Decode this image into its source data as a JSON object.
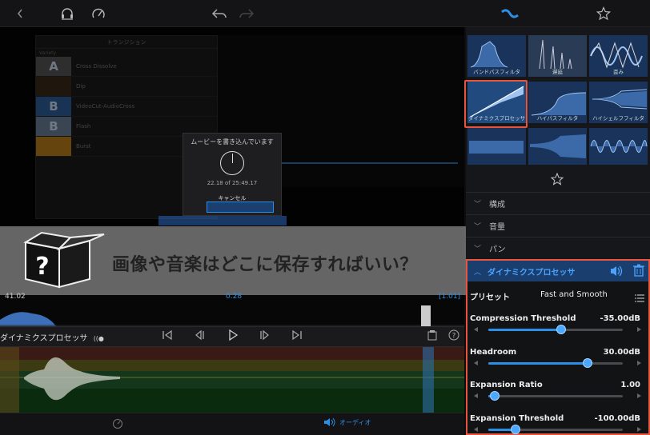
{
  "toolbar": {
    "icons": [
      "chevron-left-icon",
      "headphones-icon",
      "speedometer-icon",
      "undo-icon",
      "redo-icon",
      "effect-icon",
      "star-icon"
    ]
  },
  "transitions": {
    "title": "トランジション",
    "category": "Variety",
    "items": [
      {
        "label": "Cross Dissolve",
        "thumb": "A",
        "color": "#555"
      },
      {
        "label": "Dip",
        "thumb": "",
        "color": "#3a2a18"
      },
      {
        "label": "VideoCut-AudioCross",
        "thumb": "B",
        "color": "#2f5e9a"
      },
      {
        "label": "Flash",
        "thumb": "B",
        "color": "#6a7f99"
      },
      {
        "label": "Burst",
        "thumb": "",
        "color": "#b87d1a"
      }
    ]
  },
  "write_dialog": {
    "title": "ムービーを書き込んでいます",
    "progress_text": "22.18 of 25:49.17",
    "progress": 0.86,
    "cancel": "キャンセル"
  },
  "banner": {
    "text": "画像や音楽はどこに保存すればいい？",
    "icon": "question-box-icon"
  },
  "timeline": {
    "left_time": "41.02",
    "mid_time": "0.28",
    "right_time": "[1.01]",
    "effect_name": "ダイナミクスプロセッサ",
    "bottom_tab": "オーディオ"
  },
  "effects_grid": [
    {
      "label": "バンドパスフィルタ"
    },
    {
      "label": "遅延"
    },
    {
      "label": "歪み"
    },
    {
      "label": "ダイナミクスプロセッサ",
      "selected": true
    },
    {
      "label": "ハイパスフィルタ"
    },
    {
      "label": "ハイシェルフフィルタ"
    },
    {
      "label": ""
    },
    {
      "label": ""
    },
    {
      "label": ""
    }
  ],
  "sections": {
    "composition": "構成",
    "volume": "音量",
    "pan": "パン"
  },
  "dynamics": {
    "title": "ダイナミクスプロセッサ",
    "preset_label": "プリセット",
    "preset_value": "Fast and Smooth",
    "params": [
      {
        "label": "Compression Threshold",
        "value": "-35.00dB",
        "level": 0.54
      },
      {
        "label": "Headroom",
        "value": "30.00dB",
        "level": 0.74
      },
      {
        "label": "Expansion Ratio",
        "value": "1.00",
        "level": 0.05
      },
      {
        "label": "Expansion Threshold",
        "value": "-100.00dB",
        "level": 0.2
      }
    ]
  },
  "colors": {
    "accent": "#2b8fe8",
    "highlight": "#e8543e",
    "header_blue": "#1a3e6e"
  }
}
